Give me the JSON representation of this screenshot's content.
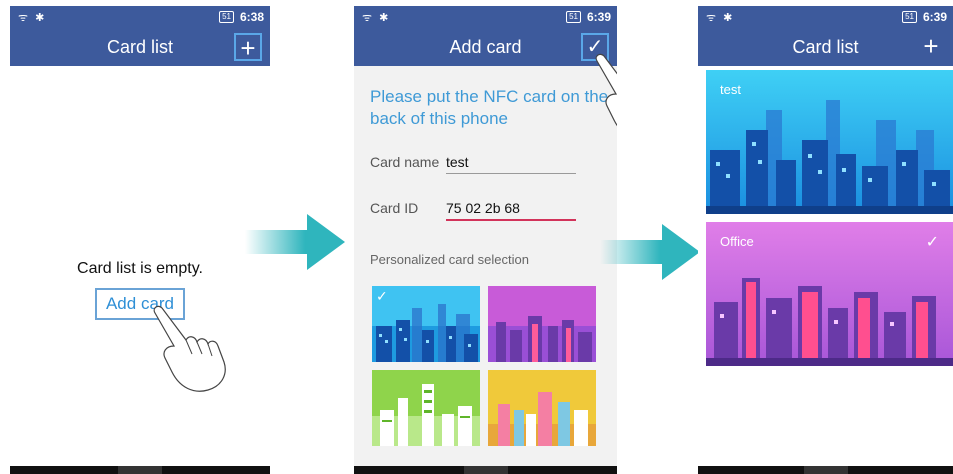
{
  "phone1": {
    "status": {
      "signal": "ᯤ ✱",
      "battery": "51",
      "time": "6:38"
    },
    "title": "Card list",
    "action_icon": "+",
    "empty_text": "Card list is empty.",
    "add_card_label": "Add card"
  },
  "phone2": {
    "status": {
      "signal": "ᯤ ✱",
      "battery": "51",
      "time": "6:39"
    },
    "title": "Add card",
    "action_icon": "✓",
    "instruction": "Please put the NFC card on the back of this phone",
    "card_name_label": "Card name",
    "card_name_value": "test",
    "card_id_label": "Card ID",
    "card_id_value": "75 02 2b 68",
    "personalized_label": "Personalized card selection",
    "selected_tick": "✓"
  },
  "phone3": {
    "status": {
      "signal": "ᯤ ✱",
      "battery": "51",
      "time": "6:39"
    },
    "title": "Card list",
    "action_icon": "+",
    "cards": [
      {
        "name": "test"
      },
      {
        "name": "Office",
        "tick": "✓"
      }
    ]
  },
  "colors": {
    "appbar": "#3d5a9c",
    "link": "#2e8fd6",
    "arrow": "#2fb5bd",
    "blue_card": "#1e9be0",
    "pink_card": "#c85bd8",
    "green_card": "#8fd44b",
    "yellow_card": "#f0c93a"
  }
}
